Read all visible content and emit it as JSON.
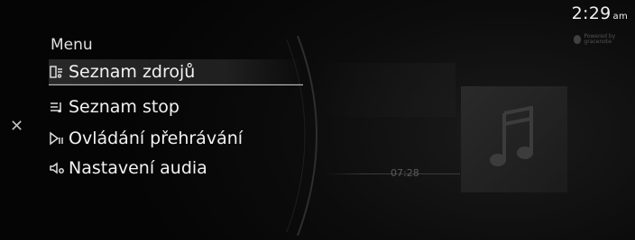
{
  "status": {
    "time": "2:29",
    "ampm": "am",
    "provider_logo_text": "Powered by gracenote"
  },
  "menu": {
    "title": "Menu",
    "items": [
      {
        "label": "Seznam zdrojů",
        "icon": "sources-list-icon",
        "selected": true
      },
      {
        "label": "Seznam stop",
        "icon": "track-list-icon",
        "selected": false
      },
      {
        "label": "Ovládání přehrávání",
        "icon": "playback-control-icon",
        "selected": false
      },
      {
        "label": "Nastavení audia",
        "icon": "audio-settings-icon",
        "selected": false
      }
    ]
  },
  "close_icon": "close-icon",
  "player": {
    "elapsed": "07:28",
    "album_art_icon": "music-note-icon"
  }
}
